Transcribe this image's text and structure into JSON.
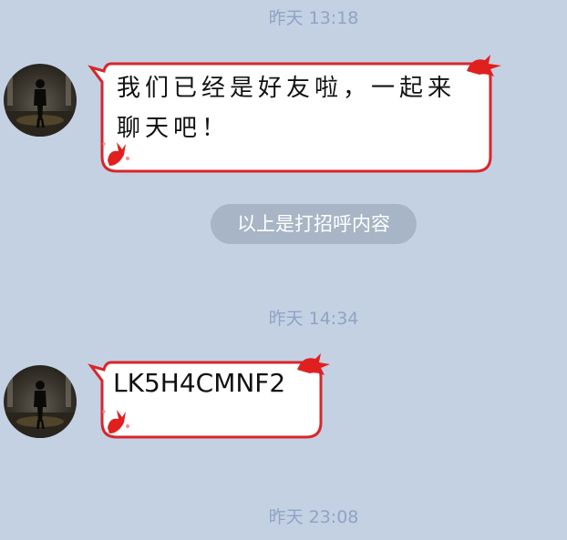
{
  "messages": [
    {
      "timestamp": "昨天 13:18",
      "text": "我们已经是好友啦，一起来聊天吧！"
    },
    {
      "notice": "以上是打招呼内容"
    },
    {
      "timestamp": "昨天 14:34",
      "text": "LK5H4CMNF2"
    },
    {
      "timestamp": "昨天 23:08"
    }
  ],
  "theme": {
    "background": "#c4d1e3",
    "bubble_border": "#d7262b",
    "timestamp_color": "#8fa3c5",
    "notice_bg": "#a7b5c6"
  }
}
